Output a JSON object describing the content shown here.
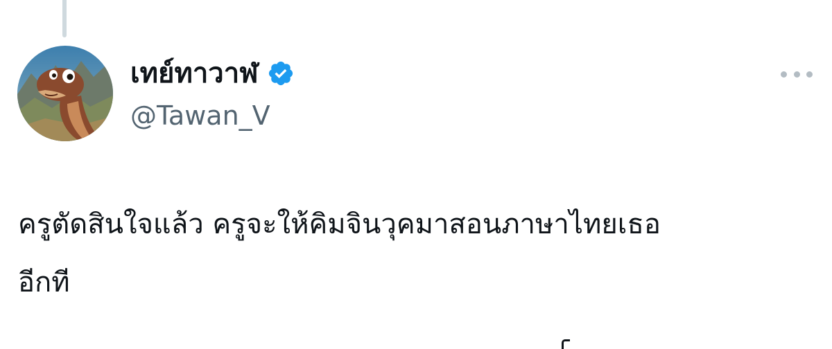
{
  "tweet": {
    "author": {
      "display_name": "เทย์ทาวาฬ",
      "handle": "@Tawan_V",
      "verified": true,
      "avatar_icon": "dinosaur-avatar-icon",
      "verified_icon": "verified-badge-icon"
    },
    "menu_icon": "more-options-icon",
    "text_lines": [
      "ครูตัดสินใจแล้ว ครูจะให้คิมจินวุคมาสอนภาษาไทยเธอ",
      "อีกที"
    ]
  },
  "colors": {
    "text_primary": "#0f1419",
    "text_secondary": "#536471",
    "verified_blue": "#1d9bf0",
    "thread_line": "#cfd9de",
    "icon_gray": "#b3bcc3"
  }
}
